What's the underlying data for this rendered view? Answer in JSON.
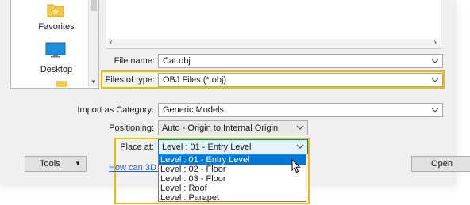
{
  "places": [
    {
      "label": "Favorites",
      "icon": "star-folder-icon"
    },
    {
      "label": "Desktop",
      "icon": "monitor-icon"
    }
  ],
  "file_name": {
    "label": "File name:",
    "value": "Car.obj"
  },
  "file_type": {
    "label": "Files of type:",
    "value": "OBJ Files  (*.obj)"
  },
  "import_category": {
    "label": "Import as Category:",
    "value": "Generic Models"
  },
  "positioning": {
    "label": "Positioning:",
    "value": "Auto - Origin to Internal Origin"
  },
  "place_at": {
    "label": "Place at:",
    "value": "Level : 01 - Entry Level",
    "options": [
      "Level : 01 - Entry Level",
      "Level : 02 - Floor",
      "Level : 03 - Floor",
      "Level : Roof",
      "Level : Parapet"
    ],
    "selected_index": 0
  },
  "tools_button": "Tools",
  "help_link": "How can 3D st",
  "open_button": "Open",
  "colors": {
    "highlight": "#f5b800",
    "selection": "#0078d7",
    "link": "#2a62c8"
  }
}
